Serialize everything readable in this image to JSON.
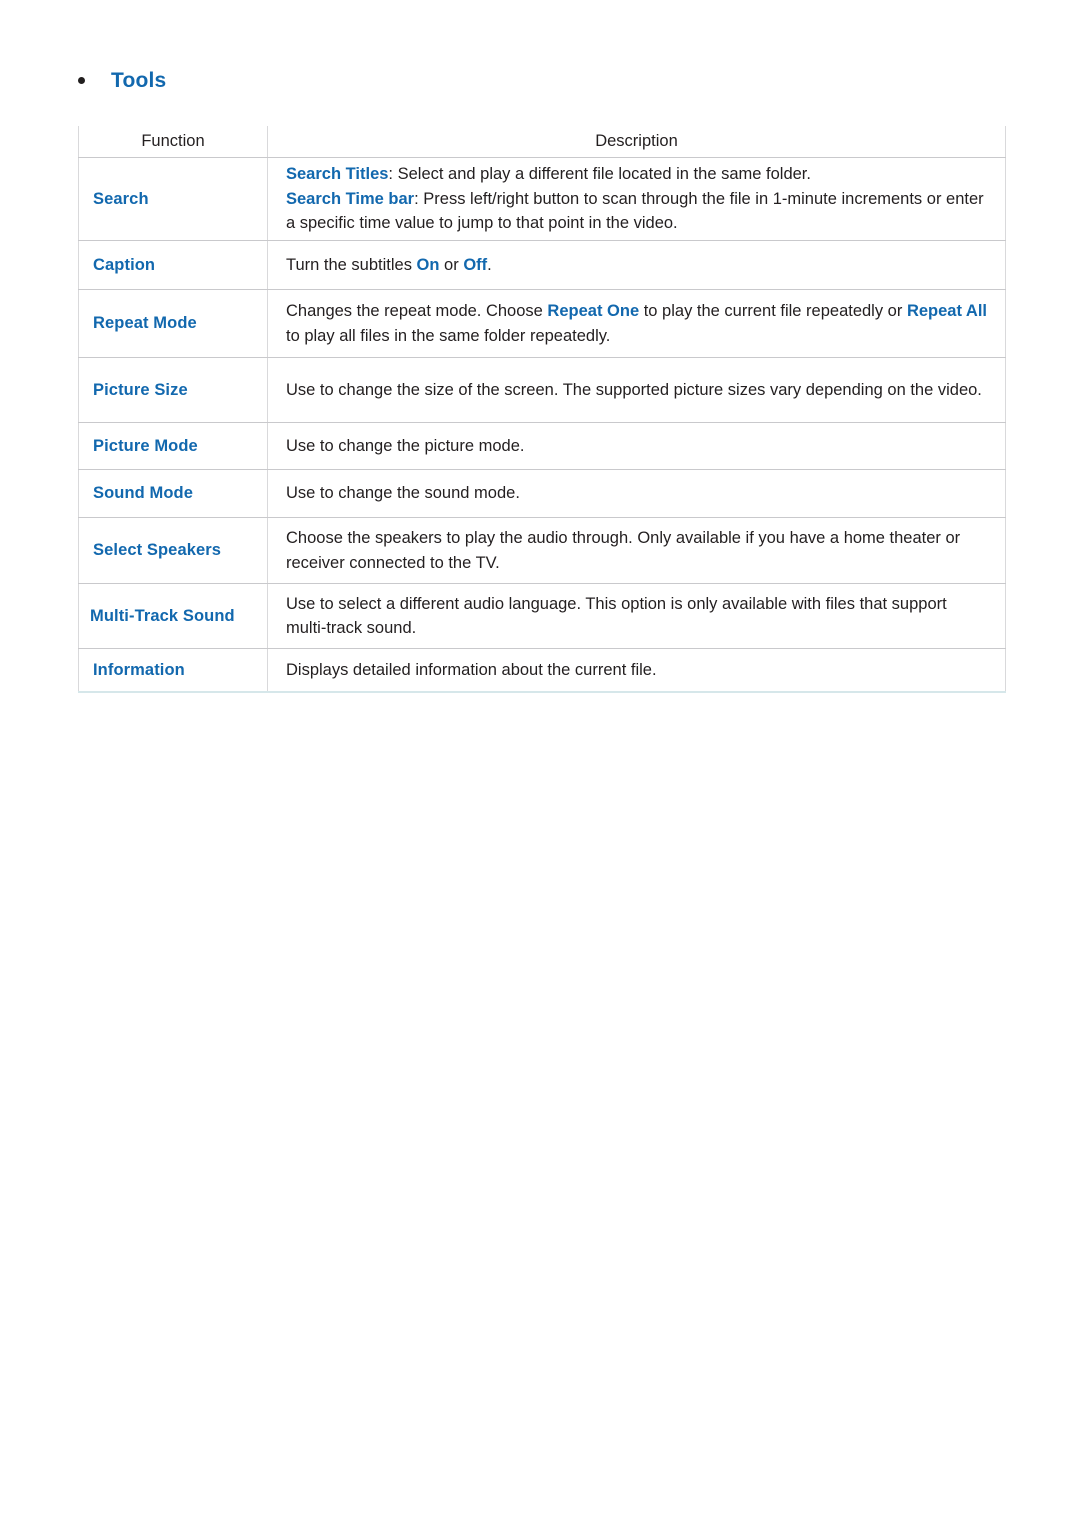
{
  "heading": {
    "bullet_icon": "bullet-dot-icon",
    "title": "Tools"
  },
  "accent_color": "#1268ae",
  "header_bg_color": "#c1c1c3",
  "table": {
    "columns": [
      {
        "key": "function",
        "label": "Function"
      },
      {
        "key": "description",
        "label": "Description"
      }
    ],
    "rows": [
      {
        "function": "Search",
        "description_parts": [
          {
            "text": "Search Titles",
            "highlight": true
          },
          {
            "text": ": Select and play a different file located in the same folder.",
            "highlight": false
          },
          {
            "break": true
          },
          {
            "text": "Search Time bar",
            "highlight": true
          },
          {
            "text": ": Press left/right button to scan through the file in 1-minute increments or enter a specific time value to jump to that point in the video.",
            "highlight": false
          }
        ],
        "description_plain": "Search Titles: Select and play a different file located in the same folder. Search Time bar: Press left/right button to scan through the file in 1-minute increments or enter a specific time value to jump to that point in the video."
      },
      {
        "function": "Caption",
        "description_parts": [
          {
            "text": "Turn the subtitles ",
            "highlight": false
          },
          {
            "text": "On",
            "highlight": true
          },
          {
            "text": " or ",
            "highlight": false
          },
          {
            "text": "Off",
            "highlight": true
          },
          {
            "text": ".",
            "highlight": false
          }
        ],
        "description_plain": "Turn the subtitles On or Off."
      },
      {
        "function": "Repeat Mode",
        "description_parts": [
          {
            "text": "Changes the repeat mode. Choose ",
            "highlight": false
          },
          {
            "text": "Repeat One",
            "highlight": true
          },
          {
            "text": " to play the current file repeatedly or ",
            "highlight": false
          },
          {
            "text": "Repeat All",
            "highlight": true
          },
          {
            "text": " to play all files in the same folder repeatedly.",
            "highlight": false
          }
        ],
        "description_plain": "Changes the repeat mode. Choose Repeat One to play the current file repeatedly or Repeat All to play all files in the same folder repeatedly."
      },
      {
        "function": "Picture Size",
        "description_parts": [
          {
            "text": "Use to change the size of the screen. The supported picture sizes vary depending on the video.",
            "highlight": false
          }
        ],
        "description_plain": "Use to change the size of the screen. The supported picture sizes vary depending on the video."
      },
      {
        "function": "Picture Mode",
        "description_parts": [
          {
            "text": "Use to change the picture mode.",
            "highlight": false
          }
        ],
        "description_plain": "Use to change the picture mode."
      },
      {
        "function": "Sound Mode",
        "description_parts": [
          {
            "text": "Use to change the sound mode.",
            "highlight": false
          }
        ],
        "description_plain": "Use to change the sound mode."
      },
      {
        "function": "Select Speakers",
        "description_parts": [
          {
            "text": "Choose the speakers to play the audio through. Only available if you have a home theater or receiver connected to the TV.",
            "highlight": false
          }
        ],
        "description_plain": "Choose the speakers to play the audio through. Only available if you have a home theater or receiver connected to the TV."
      },
      {
        "function": "Multi-Track Sound",
        "description_parts": [
          {
            "text": "Use to select a different audio language. This option is only available with files that support multi-track sound.",
            "highlight": false
          }
        ],
        "description_plain": "Use to select a different audio language. This option is only available with files that support multi-track sound."
      },
      {
        "function": "Information",
        "description_parts": [
          {
            "text": "Displays detailed information about the current file.",
            "highlight": false
          }
        ],
        "description_plain": "Displays detailed information about the current file."
      }
    ]
  }
}
